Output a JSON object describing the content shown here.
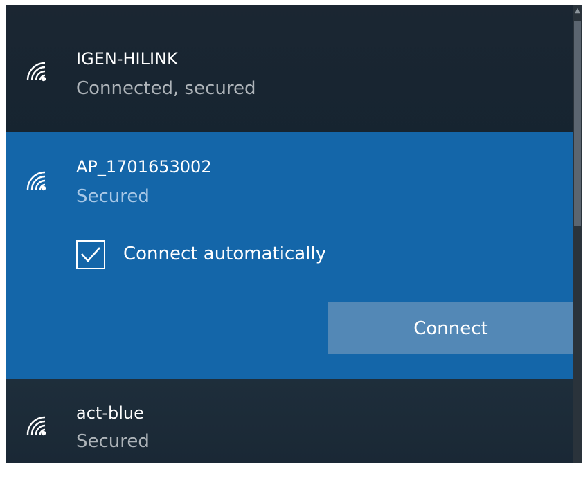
{
  "networks": [
    {
      "ssid": "IGEN-HILINK",
      "status": "Connected, secured"
    },
    {
      "ssid": "AP_1701653002",
      "status": "Secured"
    },
    {
      "ssid": "act-blue",
      "status": "Secured"
    }
  ],
  "selected_network": {
    "connect_automatically_label": "Connect automatically",
    "connect_automatically_checked": true,
    "connect_button_label": "Connect"
  },
  "icons": {
    "network": "wifi-signal-icon",
    "checkbox": "checkmark-icon",
    "scroll_up": "chevron-up-icon"
  },
  "colors": {
    "panel_background": "#152430",
    "selected_background": "#1466a9",
    "button_background": "#5388b6",
    "status_text": "#aeb4b9",
    "selected_status_text": "#a9c8e6"
  }
}
